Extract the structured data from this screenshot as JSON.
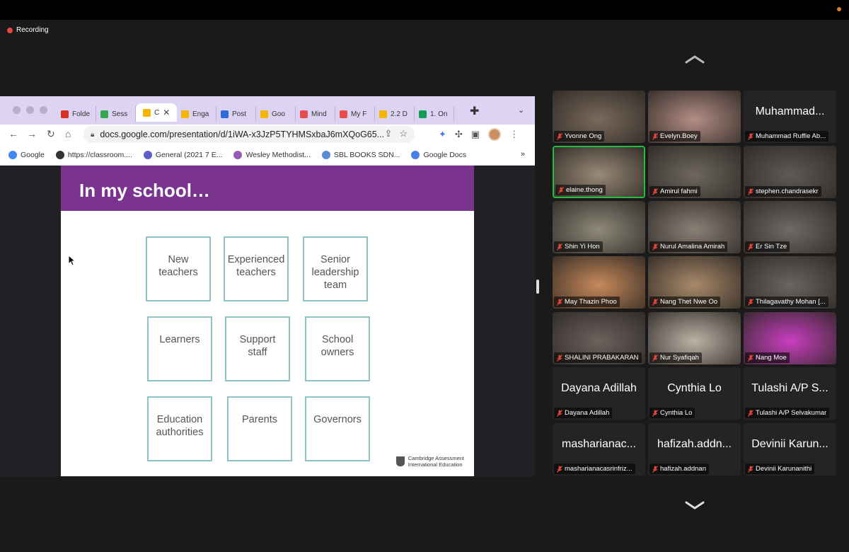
{
  "recording": "Recording",
  "browser": {
    "tabs": [
      {
        "label": "Folde",
        "color": "#d93025"
      },
      {
        "label": "Sess",
        "color": "#34a853"
      },
      {
        "label": "C",
        "color": "#f4b400",
        "active": true
      },
      {
        "label": "Enga",
        "color": "#f4b400"
      },
      {
        "label": "Post",
        "color": "#2d6cdf"
      },
      {
        "label": "Goo",
        "color": "#f4b400"
      },
      {
        "label": "Mind",
        "color": "#e84c4c"
      },
      {
        "label": "My F",
        "color": "#e84c4c"
      },
      {
        "label": "2.2 D",
        "color": "#f4b400"
      },
      {
        "label": "1. On",
        "color": "#0f9d58"
      }
    ],
    "url": "docs.google.com/presentation/d/1iWA-x3JzP5TYHMSxbaJ6mXQoG65...",
    "bookmarks": [
      {
        "label": "Google",
        "color": "#4285f4"
      },
      {
        "label": "https://classroom....",
        "color": "#333333"
      },
      {
        "label": "General (2021 7 E...",
        "color": "#5b5fc7"
      },
      {
        "label": "Wesley Methodist...",
        "color": "#9b59b6"
      },
      {
        "label": "SBL BOOKS SDN...",
        "color": "#5b8dd6"
      },
      {
        "label": "Google Docs",
        "color": "#4a7ee8"
      }
    ],
    "bookmarks_more": "»"
  },
  "slide": {
    "title": "In my school…",
    "boxes": [
      [
        "New",
        "teachers"
      ],
      [
        "Experienced",
        "teachers"
      ],
      [
        "Senior",
        "leadership",
        "team"
      ],
      [
        "Learners"
      ],
      [
        "Support",
        "staff"
      ],
      [
        "School",
        "owners"
      ],
      [
        "Education",
        "authorities"
      ],
      [
        "Parents"
      ],
      [
        "Governors"
      ]
    ],
    "logo_line1": "Cambridge Assessment",
    "logo_line2": "International Education"
  },
  "participants": [
    {
      "name": "Yvonne Ong",
      "video": "#7a6a5c"
    },
    {
      "name": "Evelyn.Boey",
      "video": "#b58e86"
    },
    {
      "name": "Muhammad Ruffie Ab...",
      "big": "Muhammad..."
    },
    {
      "name": "elaine.thong",
      "video": "#9a8a78",
      "active": true
    },
    {
      "name": "Amirul fahmi",
      "video": "#6e6760"
    },
    {
      "name": "stephen.chandrasekr",
      "video": "#5e5a56"
    },
    {
      "name": "Shin Yi Hon",
      "video": "#8f8a7a"
    },
    {
      "name": "Nurul Amalina Amirah",
      "video": "#8b8076"
    },
    {
      "name": "Er Sin Tze",
      "video": "#6f6a66"
    },
    {
      "name": "May Thazin Phoo",
      "video": "#c88a5a"
    },
    {
      "name": "Nang Thet Nwe Oo",
      "video": "#a98a6a"
    },
    {
      "name": "Thilagavathy Mohan [...",
      "video": "#6a6560"
    },
    {
      "name": "SHALINI PRABAKARAN",
      "video": "#6c625e"
    },
    {
      "name": "Nur Syafiqah",
      "video": "#bcb2a6"
    },
    {
      "name": "Nang Moe",
      "video": "#c93fc0"
    },
    {
      "name": "Dayana Adillah",
      "big": "Dayana Adillah"
    },
    {
      "name": "Cynthia Lo",
      "big": "Cynthia Lo"
    },
    {
      "name": "Tulashi A/P Selvakumar",
      "big": "Tulashi A/P S..."
    },
    {
      "name": "masharianacasrinfriz...",
      "big": "masharianac..."
    },
    {
      "name": "hafizah.addnan",
      "big": "hafizah.addn..."
    },
    {
      "name": "Devinii Karunanithi",
      "big": "Devinii Karun..."
    }
  ]
}
